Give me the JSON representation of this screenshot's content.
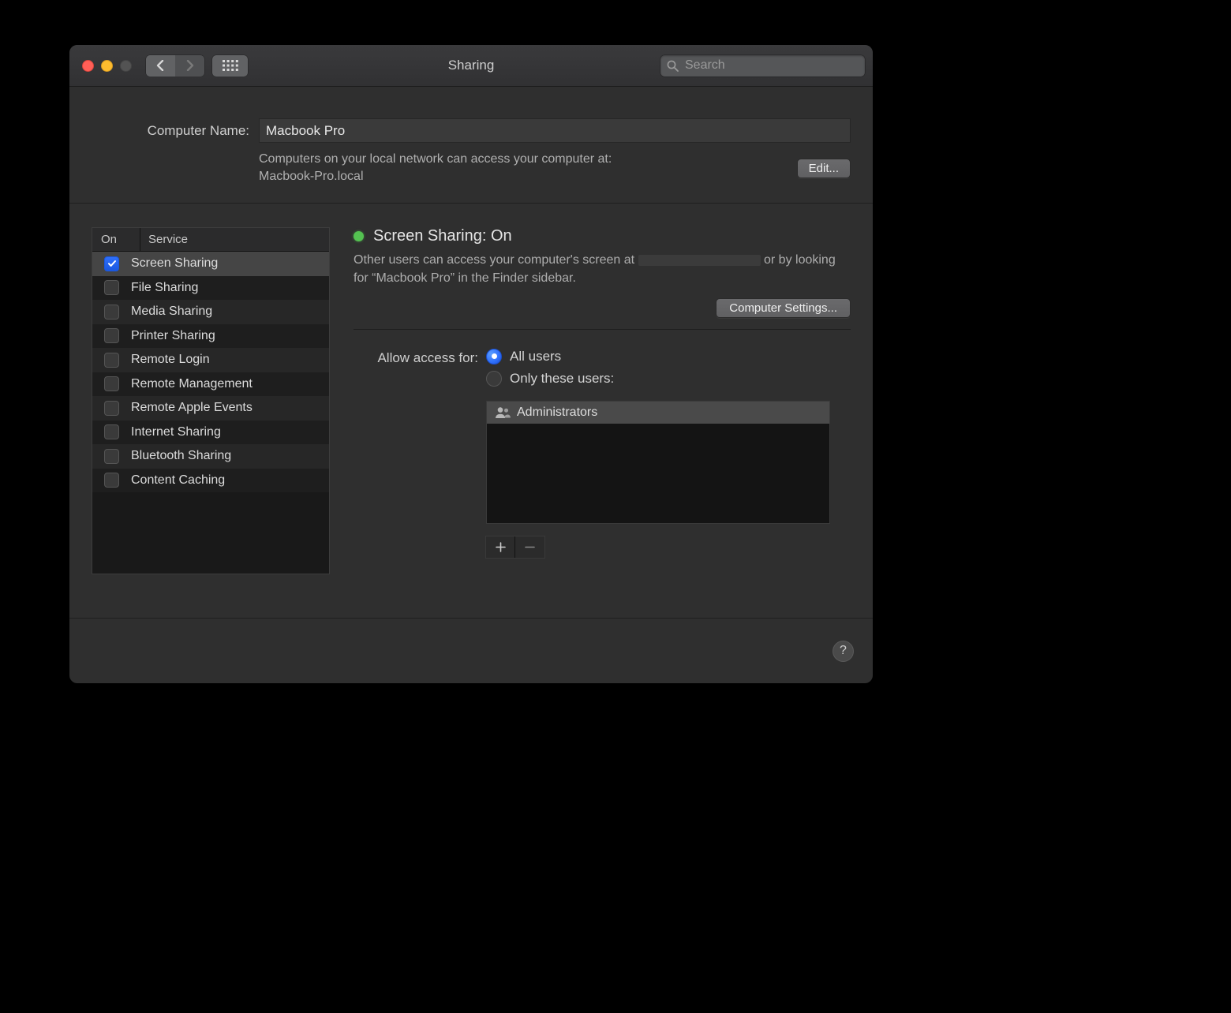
{
  "window": {
    "title": "Sharing"
  },
  "search": {
    "placeholder": "Search"
  },
  "computer_name": {
    "label": "Computer Name:",
    "value": "Macbook Pro",
    "description_line1": "Computers on your local network can access your computer at:",
    "description_line2": "Macbook-Pro.local",
    "edit_button": "Edit..."
  },
  "services": {
    "header_on": "On",
    "header_service": "Service",
    "items": [
      {
        "label": "Screen Sharing",
        "checked": true,
        "selected": true
      },
      {
        "label": "File Sharing",
        "checked": false,
        "selected": false
      },
      {
        "label": "Media Sharing",
        "checked": false,
        "selected": false
      },
      {
        "label": "Printer Sharing",
        "checked": false,
        "selected": false
      },
      {
        "label": "Remote Login",
        "checked": false,
        "selected": false
      },
      {
        "label": "Remote Management",
        "checked": false,
        "selected": false
      },
      {
        "label": "Remote Apple Events",
        "checked": false,
        "selected": false
      },
      {
        "label": "Internet Sharing",
        "checked": false,
        "selected": false
      },
      {
        "label": "Bluetooth Sharing",
        "checked": false,
        "selected": false
      },
      {
        "label": "Content Caching",
        "checked": false,
        "selected": false
      }
    ]
  },
  "detail": {
    "status_title": "Screen Sharing: On",
    "status_indicator_color": "#54c151",
    "desc_prefix": "Other users can access your computer's screen at ",
    "desc_suffix": " or by looking for “Macbook Pro” in the Finder sidebar.",
    "computer_settings_button": "Computer Settings...",
    "access_label": "Allow access for:",
    "radio_all": "All users",
    "radio_only": "Only these users:",
    "radio_selected": "all",
    "user_list": [
      "Administrators"
    ]
  },
  "footer": {
    "help_label": "?"
  }
}
